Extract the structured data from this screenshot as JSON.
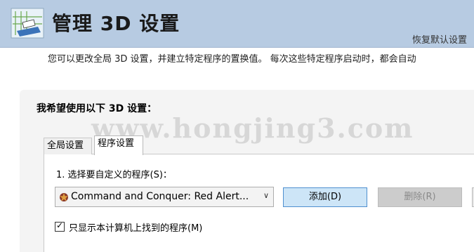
{
  "header": {
    "icon": "3d-settings-icon",
    "title": "管理 3D 设置",
    "restore_link": "恢复默认设置"
  },
  "description": "您可以更改全局 3D 设置，并建立特定程序的置换值。 每次这些特定程序启动时，都会自动",
  "panel": {
    "title": "我希望使用以下 3D 设置：",
    "watermark": "www.hongjing3.com",
    "tabs": [
      {
        "label": "全局设置",
        "active": false
      },
      {
        "label": "程序设置",
        "active": true
      }
    ],
    "step1_label": "1. 选择要自定义的程序(S)：",
    "program_select": {
      "value": "Command and Conquer: Red Alert...",
      "icon": "red-alert-app-icon"
    },
    "add_button": "添加(D)",
    "remove_button": "删除(R)",
    "show_only_found": {
      "label": "只显示本计算机上找到的程序(M)",
      "checked": true
    }
  },
  "colors": {
    "header_bg": "#b7cbe2",
    "panel_bg": "#f4f4f4",
    "add_button_bg": "#cde5f7",
    "add_button_border": "#4f8fcf",
    "disabled_button_bg": "#cccccc"
  }
}
